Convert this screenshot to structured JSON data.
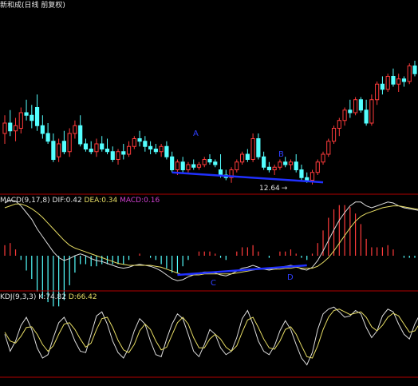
{
  "header": {
    "title": "新和成(日线 前复权)"
  },
  "colors": {
    "background": "#000000",
    "up": "#ff3b3b",
    "down": "#54ffff",
    "separator": "#b00000",
    "white_line": "#dcdcdc",
    "yellow_line": "#e6dc64",
    "macd": "#d040d0",
    "divergence": "#2030ff"
  },
  "annotations": {
    "A": "A",
    "B": "B",
    "C": "C",
    "D": "D"
  },
  "low_marker": {
    "text": "12.64",
    "arrow": "→"
  },
  "chart_data": [
    {
      "type": "candlestick",
      "title": "新和成(日线 前复权)",
      "low_label": 12.64,
      "candles": [
        {
          "o": 14.6,
          "h": 15.3,
          "l": 14.2,
          "c": 15.0
        },
        {
          "o": 15.0,
          "h": 15.5,
          "l": 14.5,
          "c": 14.7
        },
        {
          "o": 14.7,
          "h": 15.2,
          "l": 14.3,
          "c": 14.9
        },
        {
          "o": 14.8,
          "h": 15.6,
          "l": 14.6,
          "c": 15.4
        },
        {
          "o": 15.4,
          "h": 15.9,
          "l": 15.1,
          "c": 15.3
        },
        {
          "o": 15.3,
          "h": 15.7,
          "l": 14.8,
          "c": 15.1
        },
        {
          "o": 15.6,
          "h": 16.1,
          "l": 14.7,
          "c": 14.9
        },
        {
          "o": 14.9,
          "h": 15.3,
          "l": 14.4,
          "c": 14.6
        },
        {
          "o": 14.6,
          "h": 15.0,
          "l": 14.2,
          "c": 14.3
        },
        {
          "o": 14.3,
          "h": 14.6,
          "l": 13.5,
          "c": 13.6
        },
        {
          "o": 13.7,
          "h": 14.4,
          "l": 13.5,
          "c": 14.2
        },
        {
          "o": 14.3,
          "h": 14.7,
          "l": 13.8,
          "c": 13.9
        },
        {
          "o": 13.9,
          "h": 14.8,
          "l": 13.7,
          "c": 14.6
        },
        {
          "o": 14.6,
          "h": 15.1,
          "l": 14.4,
          "c": 14.9
        },
        {
          "o": 14.9,
          "h": 15.3,
          "l": 14.1,
          "c": 14.2
        },
        {
          "o": 14.2,
          "h": 14.4,
          "l": 13.9,
          "c": 14.0
        },
        {
          "o": 14.0,
          "h": 14.3,
          "l": 13.8,
          "c": 13.9
        },
        {
          "o": 13.9,
          "h": 14.4,
          "l": 13.7,
          "c": 14.2
        },
        {
          "o": 14.2,
          "h": 14.5,
          "l": 13.9,
          "c": 14.0
        },
        {
          "o": 14.0,
          "h": 14.4,
          "l": 13.8,
          "c": 13.9
        },
        {
          "o": 13.9,
          "h": 14.1,
          "l": 13.5,
          "c": 13.6
        },
        {
          "o": 13.6,
          "h": 14.0,
          "l": 13.4,
          "c": 13.9
        },
        {
          "o": 13.9,
          "h": 14.2,
          "l": 13.6,
          "c": 13.8
        },
        {
          "o": 13.8,
          "h": 14.3,
          "l": 13.7,
          "c": 14.1
        },
        {
          "o": 14.1,
          "h": 14.5,
          "l": 14.0,
          "c": 14.4
        },
        {
          "o": 14.4,
          "h": 14.7,
          "l": 14.1,
          "c": 14.3
        },
        {
          "o": 14.3,
          "h": 14.5,
          "l": 13.9,
          "c": 14.1
        },
        {
          "o": 14.1,
          "h": 14.3,
          "l": 13.8,
          "c": 14.0
        },
        {
          "o": 14.0,
          "h": 14.2,
          "l": 13.8,
          "c": 13.9
        },
        {
          "o": 13.9,
          "h": 14.2,
          "l": 13.7,
          "c": 14.1
        },
        {
          "o": 14.1,
          "h": 14.3,
          "l": 13.6,
          "c": 13.7
        },
        {
          "o": 13.7,
          "h": 13.9,
          "l": 13.1,
          "c": 13.2
        },
        {
          "o": 13.2,
          "h": 13.6,
          "l": 13.0,
          "c": 13.5
        },
        {
          "o": 13.5,
          "h": 13.7,
          "l": 13.1,
          "c": 13.2
        },
        {
          "o": 13.2,
          "h": 13.5,
          "l": 13.1,
          "c": 13.4
        },
        {
          "o": 13.4,
          "h": 13.6,
          "l": 13.2,
          "c": 13.3
        },
        {
          "o": 13.3,
          "h": 13.5,
          "l": 13.2,
          "c": 13.4
        },
        {
          "o": 13.4,
          "h": 13.7,
          "l": 13.3,
          "c": 13.6
        },
        {
          "o": 13.6,
          "h": 13.8,
          "l": 13.4,
          "c": 13.5
        },
        {
          "o": 13.5,
          "h": 13.6,
          "l": 13.3,
          "c": 13.4
        },
        {
          "o": 13.2,
          "h": 13.8,
          "l": 12.9,
          "c": 13.0
        },
        {
          "o": 13.0,
          "h": 13.2,
          "l": 12.8,
          "c": 12.9
        },
        {
          "o": 12.9,
          "h": 13.3,
          "l": 12.7,
          "c": 13.2
        },
        {
          "o": 13.2,
          "h": 13.6,
          "l": 13.1,
          "c": 13.5
        },
        {
          "o": 13.5,
          "h": 13.9,
          "l": 13.4,
          "c": 13.8
        },
        {
          "o": 13.8,
          "h": 14.0,
          "l": 13.5,
          "c": 13.6
        },
        {
          "o": 13.6,
          "h": 14.6,
          "l": 13.5,
          "c": 14.4
        },
        {
          "o": 14.4,
          "h": 14.6,
          "l": 13.6,
          "c": 13.7
        },
        {
          "o": 13.7,
          "h": 13.9,
          "l": 13.2,
          "c": 13.3
        },
        {
          "o": 13.3,
          "h": 13.5,
          "l": 13.1,
          "c": 13.2
        },
        {
          "o": 13.2,
          "h": 13.4,
          "l": 13.0,
          "c": 13.3
        },
        {
          "o": 13.3,
          "h": 13.6,
          "l": 13.2,
          "c": 13.5
        },
        {
          "o": 13.5,
          "h": 13.7,
          "l": 13.3,
          "c": 13.4
        },
        {
          "o": 13.4,
          "h": 13.6,
          "l": 13.2,
          "c": 13.5
        },
        {
          "o": 13.5,
          "h": 13.8,
          "l": 13.1,
          "c": 13.2
        },
        {
          "o": 13.2,
          "h": 13.4,
          "l": 12.8,
          "c": 12.9
        },
        {
          "o": 12.9,
          "h": 13.1,
          "l": 12.7,
          "c": 12.8
        },
        {
          "o": 12.8,
          "h": 13.2,
          "l": 12.64,
          "c": 13.1
        },
        {
          "o": 13.1,
          "h": 13.6,
          "l": 13.0,
          "c": 13.5
        },
        {
          "o": 13.5,
          "h": 13.9,
          "l": 13.4,
          "c": 13.8
        },
        {
          "o": 13.8,
          "h": 14.4,
          "l": 13.7,
          "c": 14.3
        },
        {
          "o": 14.3,
          "h": 14.9,
          "l": 14.2,
          "c": 14.8
        },
        {
          "o": 14.8,
          "h": 15.2,
          "l": 14.5,
          "c": 15.1
        },
        {
          "o": 15.1,
          "h": 15.6,
          "l": 14.9,
          "c": 15.5
        },
        {
          "o": 15.5,
          "h": 15.9,
          "l": 15.2,
          "c": 15.4
        },
        {
          "o": 15.4,
          "h": 16.0,
          "l": 15.3,
          "c": 15.9
        },
        {
          "o": 15.9,
          "h": 16.0,
          "l": 15.4,
          "c": 15.5
        },
        {
          "o": 15.5,
          "h": 15.9,
          "l": 14.9,
          "c": 15.0
        },
        {
          "o": 15.0,
          "h": 16.1,
          "l": 14.9,
          "c": 15.9
        },
        {
          "o": 15.9,
          "h": 16.6,
          "l": 15.7,
          "c": 16.5
        },
        {
          "o": 16.5,
          "h": 16.8,
          "l": 16.1,
          "c": 16.3
        },
        {
          "o": 16.3,
          "h": 16.9,
          "l": 16.2,
          "c": 16.8
        },
        {
          "o": 16.8,
          "h": 17.1,
          "l": 16.4,
          "c": 16.5
        },
        {
          "o": 16.5,
          "h": 16.9,
          "l": 16.2,
          "c": 16.7
        },
        {
          "o": 16.7,
          "h": 16.8,
          "l": 16.4,
          "c": 16.6
        },
        {
          "o": 16.6,
          "h": 17.3,
          "l": 16.5,
          "c": 17.2
        },
        {
          "o": 17.2,
          "h": 17.4,
          "l": 16.8,
          "c": 16.9
        }
      ]
    },
    {
      "type": "macd",
      "params": "MACD(9,17,8)",
      "dif": 0.42,
      "dea": 0.34,
      "macd": 0.16,
      "dif_series": [
        0.55,
        0.58,
        0.57,
        0.52,
        0.45,
        0.38,
        0.28,
        0.2,
        0.12,
        0.04,
        -0.02,
        -0.05,
        -0.03,
        0.0,
        0.02,
        0.0,
        -0.03,
        -0.05,
        -0.06,
        -0.08,
        -0.1,
        -0.12,
        -0.13,
        -0.12,
        -0.1,
        -0.09,
        -0.1,
        -0.11,
        -0.13,
        -0.16,
        -0.2,
        -0.24,
        -0.26,
        -0.25,
        -0.22,
        -0.2,
        -0.18,
        -0.17,
        -0.17,
        -0.18,
        -0.2,
        -0.21,
        -0.19,
        -0.16,
        -0.13,
        -0.12,
        -0.1,
        -0.12,
        -0.14,
        -0.15,
        -0.14,
        -0.12,
        -0.11,
        -0.1,
        -0.11,
        -0.14,
        -0.15,
        -0.12,
        -0.05,
        0.05,
        0.16,
        0.27,
        0.37,
        0.45,
        0.52,
        0.56,
        0.56,
        0.52,
        0.5,
        0.52,
        0.54,
        0.56,
        0.55,
        0.52,
        0.5,
        0.49,
        0.48,
        0.47,
        0.46
      ],
      "dea_series": [
        0.5,
        0.52,
        0.54,
        0.54,
        0.52,
        0.49,
        0.45,
        0.4,
        0.34,
        0.28,
        0.22,
        0.16,
        0.11,
        0.08,
        0.06,
        0.04,
        0.02,
        0.0,
        -0.02,
        -0.04,
        -0.06,
        -0.08,
        -0.09,
        -0.1,
        -0.1,
        -0.1,
        -0.1,
        -0.1,
        -0.11,
        -0.12,
        -0.14,
        -0.16,
        -0.18,
        -0.2,
        -0.2,
        -0.2,
        -0.2,
        -0.19,
        -0.19,
        -0.19,
        -0.19,
        -0.19,
        -0.19,
        -0.18,
        -0.17,
        -0.16,
        -0.15,
        -0.14,
        -0.14,
        -0.14,
        -0.14,
        -0.14,
        -0.13,
        -0.13,
        -0.12,
        -0.13,
        -0.13,
        -0.13,
        -0.11,
        -0.07,
        -0.02,
        0.05,
        0.13,
        0.21,
        0.29,
        0.36,
        0.41,
        0.44,
        0.46,
        0.48,
        0.5,
        0.51,
        0.52,
        0.52,
        0.51,
        0.5,
        0.49,
        0.48,
        0.48
      ],
      "divergence_line": [
        "C",
        "D"
      ]
    },
    {
      "type": "kdj",
      "params": "KDJ(9,3,3)",
      "k": 74.82,
      "d": 66.42,
      "k_series": [
        55,
        30,
        45,
        68,
        80,
        62,
        35,
        20,
        25,
        50,
        72,
        80,
        65,
        45,
        30,
        28,
        55,
        82,
        88,
        70,
        45,
        28,
        20,
        35,
        60,
        78,
        70,
        45,
        25,
        22,
        48,
        70,
        85,
        78,
        55,
        30,
        22,
        40,
        62,
        55,
        35,
        25,
        30,
        50,
        78,
        90,
        70,
        45,
        30,
        25,
        38,
        60,
        75,
        62,
        40,
        20,
        10,
        28,
        62,
        85,
        92,
        95,
        88,
        80,
        82,
        90,
        85,
        65,
        50,
        60,
        82,
        92,
        88,
        70,
        55,
        48,
        70,
        85,
        74.82
      ],
      "d_series": [
        58,
        45,
        42,
        52,
        65,
        66,
        55,
        40,
        30,
        38,
        55,
        70,
        72,
        62,
        48,
        36,
        42,
        62,
        78,
        80,
        65,
        46,
        32,
        28,
        40,
        60,
        70,
        62,
        45,
        32,
        36,
        54,
        72,
        80,
        70,
        50,
        35,
        35,
        48,
        55,
        48,
        36,
        30,
        38,
        58,
        76,
        80,
        65,
        48,
        35,
        33,
        45,
        62,
        66,
        55,
        38,
        22,
        20,
        38,
        62,
        80,
        90,
        92,
        88,
        84,
        86,
        88,
        80,
        66,
        60,
        68,
        80,
        86,
        82,
        70,
        58,
        60,
        72,
        66.42
      ]
    }
  ]
}
